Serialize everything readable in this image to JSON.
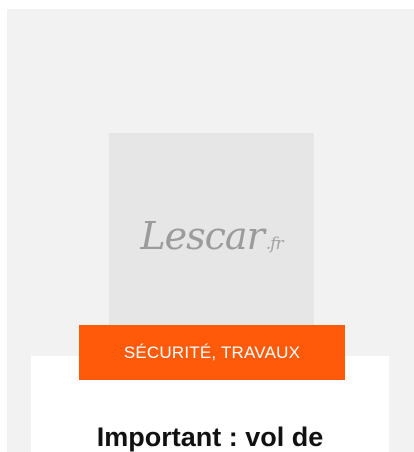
{
  "thumbnail": {
    "logo_text": "Lescar",
    "logo_suffix": ".fr"
  },
  "post": {
    "categories": "SÉCURITÉ, TRAVAUX",
    "title": "Important : vol de"
  },
  "colors": {
    "accent": "#ff5a0a",
    "panel_background": "#f2f2f2",
    "placeholder_background": "#e6e6e6",
    "card_background": "#ffffff",
    "logo": "#9b9b9b"
  }
}
